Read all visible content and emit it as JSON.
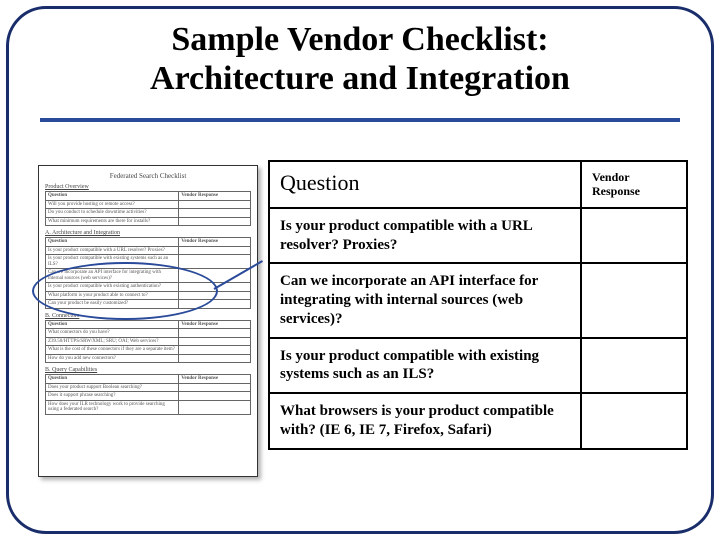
{
  "title_line1": "Sample Vendor Checklist:",
  "title_line2": "Architecture and Integration",
  "thumb": {
    "doc_title": "Federated Search Checklist",
    "section_a": "Product Overview",
    "section_b": "A. Architecture and Integration",
    "section_c": "B. Connectors",
    "section_d": "B. Query Capabilities",
    "hdr_q": "Question",
    "hdr_r": "Vendor Response",
    "row_a1": "Will you provide hosting or remote access?",
    "row_a2": "Do you conduct to schedule downtime activities?",
    "row_a3": "What minimum requirements are there for installs?",
    "row_b1": "Is your product compatible with a URL resolver? Proxies?",
    "row_b2": "Is your product compatible with existing systems such as an ILS?",
    "row_b3": "Can we incorporate an API interface for integrating with internal sources (web services)?",
    "row_b4": "Is your product compatible with existing authentication?",
    "row_b5": "What platform is your product able to connect to?",
    "row_b6": "Can your product be easily customized?",
    "row_c1": "What connectors do you have?",
    "row_c2": "Z39.50/HTTPS/SRW/XML; SRU; OAI; Web services?",
    "row_c3": "What is the cost of these connectors if they are a separate item?",
    "row_c4": "How do you add new connectors?",
    "row_d1": "Does your product support Boolean searching?",
    "row_d2": "Does it support phrase searching?",
    "row_d3": "How does your ILR technology work to provide searching using a federated search?"
  },
  "table": {
    "header_question": "Question",
    "header_response": "Vendor Response",
    "rows": [
      {
        "q": "Is your product compatible with a URL resolver? Proxies?",
        "r": ""
      },
      {
        "q": "Can we incorporate an API interface for integrating with internal sources (web services)?",
        "r": ""
      },
      {
        "q": "Is your product compatible with existing systems such as an ILS?",
        "r": ""
      },
      {
        "q": "What browsers is your product compatible with? (IE 6, IE 7, Firefox, Safari)",
        "r": ""
      }
    ]
  }
}
